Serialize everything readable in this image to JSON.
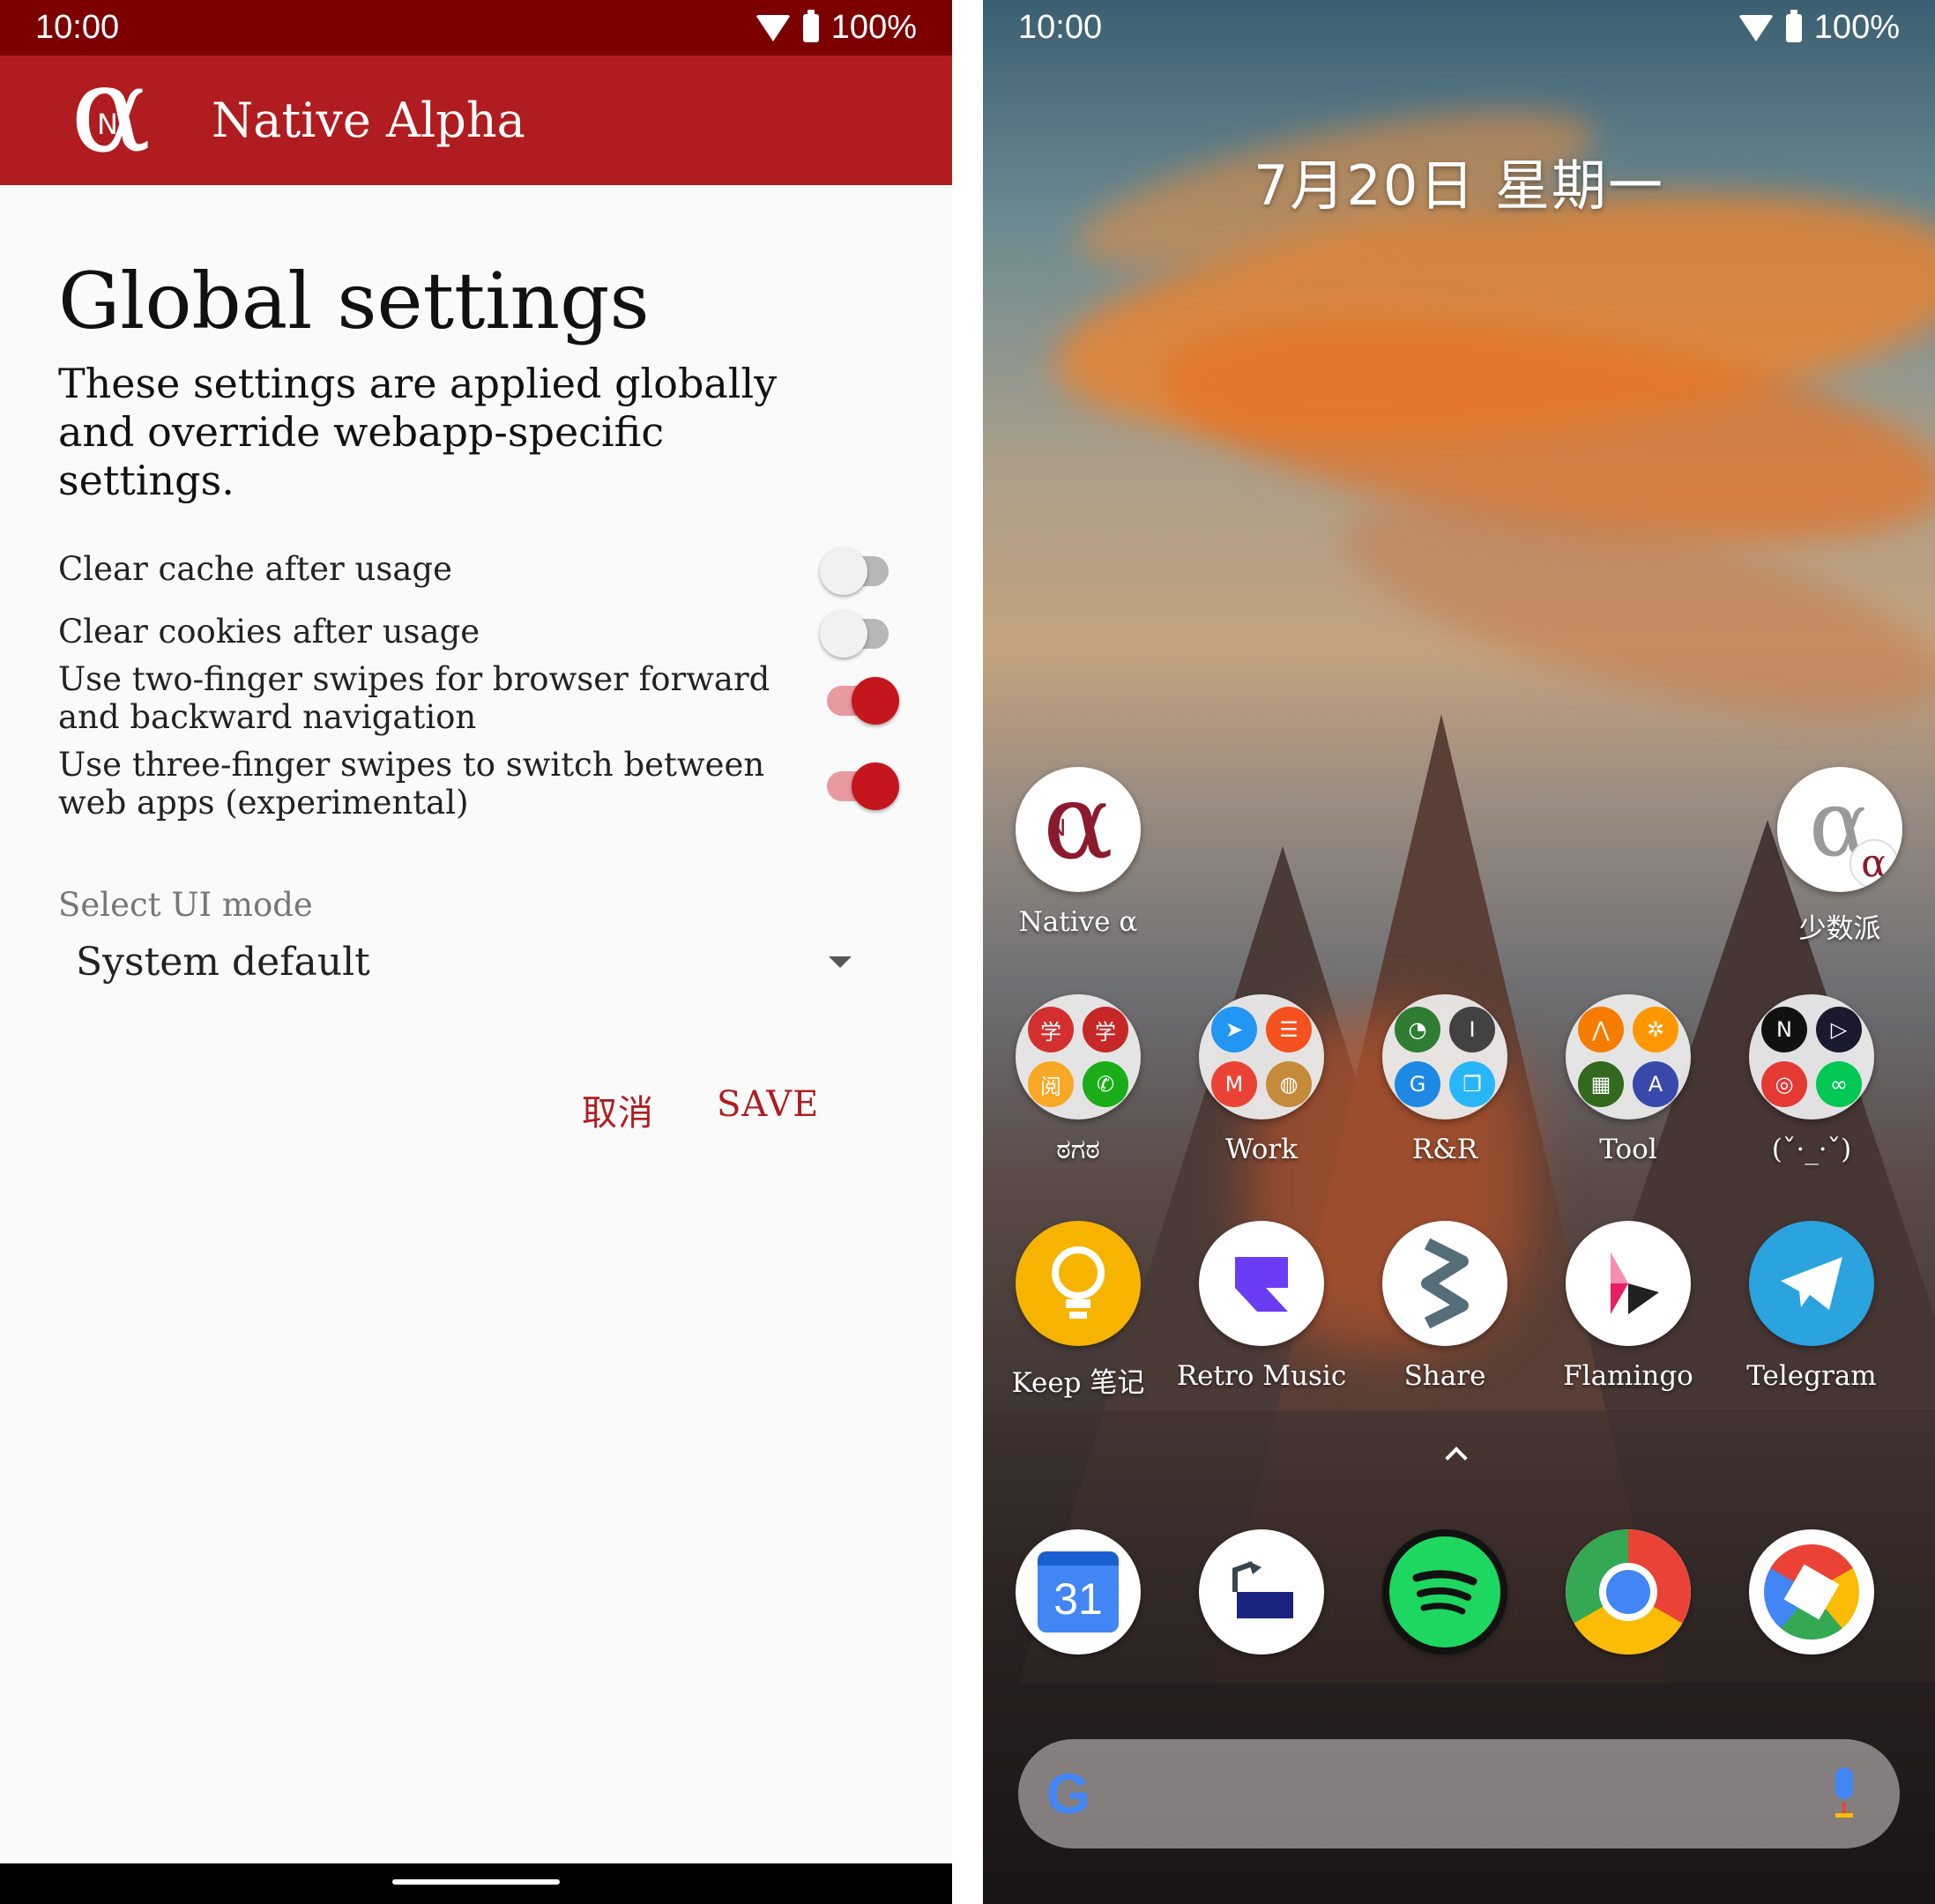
{
  "left": {
    "status": {
      "time": "10:00",
      "battery": "100%"
    },
    "appbar": {
      "logo_glyph": "α",
      "logo_n": "N",
      "title": "Native Alpha"
    },
    "title": "Global settings",
    "description": "These settings are applied globally and override webapp-specific settings.",
    "settings": [
      {
        "label": "Clear cache after usage",
        "enabled": false
      },
      {
        "label": "Clear cookies after usage",
        "enabled": false
      },
      {
        "label": "Use two-finger swipes for browser forward and backward navigation",
        "enabled": true
      },
      {
        "label": "Use three-finger swipes to switch between web apps (experimental)",
        "enabled": true
      }
    ],
    "ui_mode": {
      "label": "Select UI mode",
      "value": "System default"
    },
    "buttons": {
      "cancel": "取消",
      "save": "SAVE"
    },
    "colors": {
      "primary": "#b01c1f",
      "statusbar": "#7c0000",
      "switch_on": "#c5161d"
    }
  },
  "right": {
    "status": {
      "time": "10:00",
      "battery": "100%"
    },
    "date": "7月20日 星期一",
    "row1": [
      {
        "label": "Native α",
        "icon": "native-alpha-icon"
      },
      {
        "label": "少数派",
        "icon": "sspai-alpha-icon"
      }
    ],
    "folders": [
      {
        "label": "ಠಗಠ",
        "icons": [
          "学",
          "学",
          "阅",
          "✆"
        ],
        "colors": [
          "#d32f2f",
          "#c62828",
          "#f9a825",
          "#1aad19"
        ]
      },
      {
        "label": "Work",
        "icons": [
          "➤",
          "☰",
          "M",
          "◍"
        ],
        "colors": [
          "#2196f3",
          "#f4511e",
          "#ea4335",
          "#c58a3a"
        ]
      },
      {
        "label": "R&R",
        "icons": [
          "◔",
          "I",
          "G",
          "❐"
        ],
        "colors": [
          "#2e7d32",
          "#424242",
          "#1e88e5",
          "#29b6f6"
        ]
      },
      {
        "label": "Tool",
        "icons": [
          "⋀",
          "✲",
          "▦",
          "A"
        ],
        "colors": [
          "#f57c00",
          "#ff9800",
          "#33691e",
          "#3949ab"
        ]
      },
      {
        "label": "(ˇ·_·ˇ)",
        "icons": [
          "N",
          "▷",
          "◎",
          "∞"
        ],
        "colors": [
          "#e50914",
          "#5e35b1",
          "#e53935",
          "#00c853"
        ]
      }
    ],
    "row3": [
      {
        "label": "Keep 笔记",
        "icon": "keep-icon",
        "color": "#f6b400"
      },
      {
        "label": "Retro Music",
        "icon": "retro-music-icon",
        "color": "#6a3df5"
      },
      {
        "label": "Share",
        "icon": "share-icon",
        "color": "#546e7a"
      },
      {
        "label": "Flamingo",
        "icon": "flamingo-icon",
        "color": "#e91e63"
      },
      {
        "label": "Telegram",
        "icon": "telegram-icon",
        "color": "#2aa3df"
      }
    ],
    "dock": [
      {
        "icon": "calendar-icon",
        "text": "31",
        "color": "#4285f4"
      },
      {
        "icon": "desk-lamp-icon",
        "color": "#1a237e"
      },
      {
        "icon": "spotify-icon",
        "color": "#1ed760"
      },
      {
        "icon": "chrome-icon",
        "color": "#4285f4"
      },
      {
        "icon": "camera-icon",
        "color": "#ea4335"
      }
    ],
    "search": {
      "logo": "G"
    }
  }
}
